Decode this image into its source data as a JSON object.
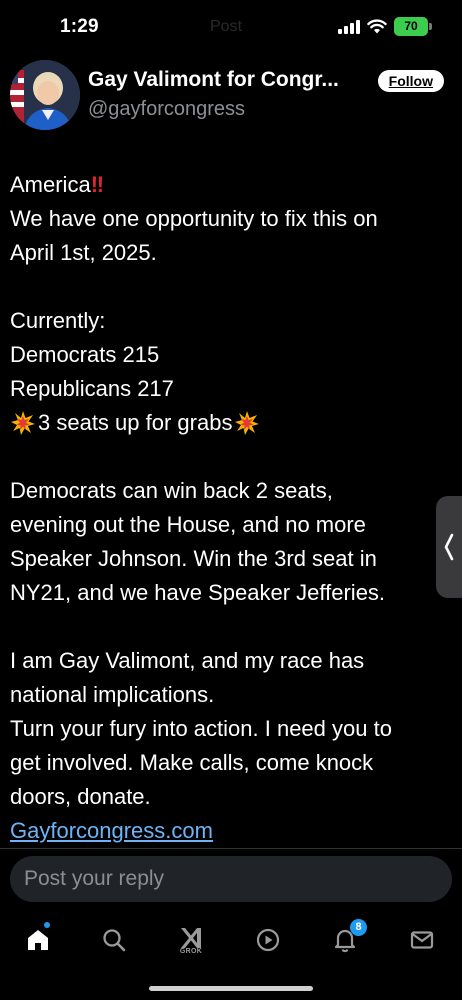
{
  "status_bar": {
    "time": "1:29",
    "faded_title": "Post",
    "battery": "70"
  },
  "author": {
    "name": "Gay Valimont for Congr...",
    "handle": "@gayforcongress",
    "follow_label": "Follow"
  },
  "post": {
    "lines": [
      "America",
      "We have one opportunity to fix this on",
      "April 1st, 2025.",
      "",
      "Currently:",
      "Democrats 215",
      "Republicans 217",
      "3 seats up for grabs",
      "",
      "Democrats can win back 2 seats,",
      "evening out the House, and no more",
      "Speaker Johnson. Win the 3rd seat in",
      "NY21, and we have Speaker Jefferies.",
      "",
      "I am Gay Valimont, and my race has",
      "national implications.",
      "Turn your fury into action. I need you to",
      "get involved. Make calls, come knock",
      "doors, donate."
    ],
    "exclamation": "‼",
    "link": "Gayforcongress.com"
  },
  "reply": {
    "placeholder": "Post your reply"
  },
  "nav": {
    "grok_label": "GROK",
    "notifications_count": "8",
    "icons": [
      "home-icon",
      "search-icon",
      "grok-icon",
      "play-icon",
      "bell-icon",
      "mail-icon"
    ]
  },
  "colors": {
    "background": "#000000",
    "link": "#6eb3f7",
    "accent": "#1d9bf0",
    "battery": "#3ccd4f",
    "reply_bg": "#202327"
  }
}
